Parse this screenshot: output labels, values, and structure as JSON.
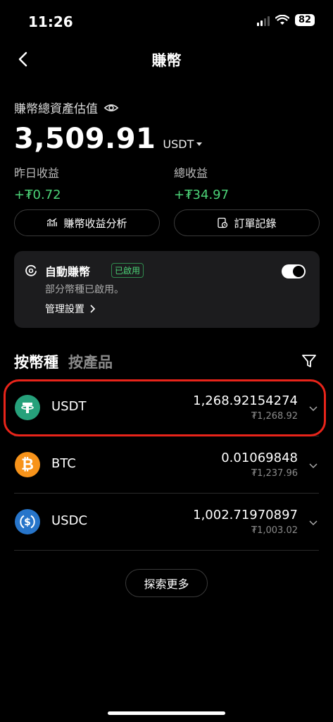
{
  "status": {
    "time": "11:26",
    "battery": "82"
  },
  "nav": {
    "title": "賺幣"
  },
  "summary": {
    "label": "賺幣總資產估值",
    "value": "3,509.91",
    "unit": "USDT",
    "yesterday_label": "昨日收益",
    "yesterday_value": "+₮0.72",
    "total_label": "總收益",
    "total_value": "+₮34.97"
  },
  "buttons": {
    "analysis": "賺幣收益分析",
    "orders": "訂單記錄"
  },
  "auto_earn": {
    "title": "自動賺幣",
    "badge": "已啟用",
    "subtitle": "部分幣種已啟用。",
    "manage": "管理設置"
  },
  "tabs": {
    "by_coin": "按幣種",
    "by_product": "按產品"
  },
  "coins": [
    {
      "name": "USDT",
      "amount": "1,268.92154274",
      "fiat": "₮1,268.92",
      "color": "#26a17b",
      "icon": "tether-icon"
    },
    {
      "name": "BTC",
      "amount": "0.01069848",
      "fiat": "₮1,237.96",
      "color": "#f7931a",
      "icon": "bitcoin-icon"
    },
    {
      "name": "USDC",
      "amount": "1,002.71970897",
      "fiat": "₮1,003.02",
      "color": "#2775ca",
      "icon": "usdc-icon"
    }
  ],
  "explore": {
    "label": "探索更多"
  },
  "colors": {
    "positive": "#4cd377",
    "highlight": "#e8241a"
  }
}
